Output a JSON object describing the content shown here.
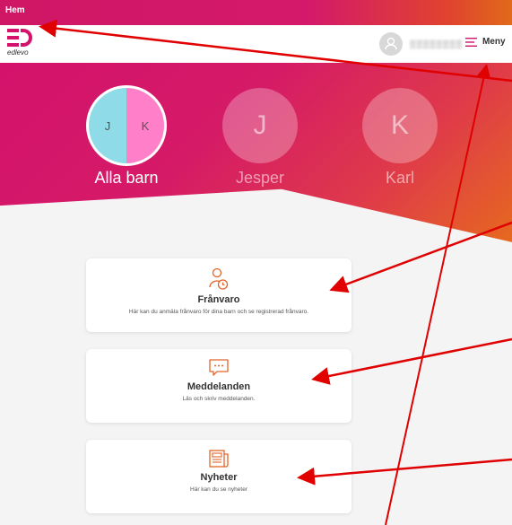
{
  "top_strip": {
    "home_label": "Hem"
  },
  "header": {
    "brand": "edlevo",
    "user_name": "▒▒▒▒▒▒▒▒",
    "menu_label": "Meny"
  },
  "children": [
    {
      "name": "Alla barn",
      "initials": [
        "J",
        "K"
      ]
    },
    {
      "name": "Jesper",
      "initial": "J"
    },
    {
      "name": "Karl",
      "initial": "K"
    }
  ],
  "cards": [
    {
      "title": "Frånvaro",
      "description": "Här kan du anmäla frånvaro för dina barn och se registrerad frånvaro.",
      "icon": "person-clock-icon"
    },
    {
      "title": "Meddelanden",
      "description": "Läs och skriv meddelanden.",
      "icon": "chat-bubble-icon"
    },
    {
      "title": "Nyheter",
      "description": "Här kan du se nyheter",
      "icon": "newspaper-icon"
    }
  ],
  "colors": {
    "brand": "#d4126c",
    "accent": "#e3632b",
    "annotation": "#e00000"
  }
}
